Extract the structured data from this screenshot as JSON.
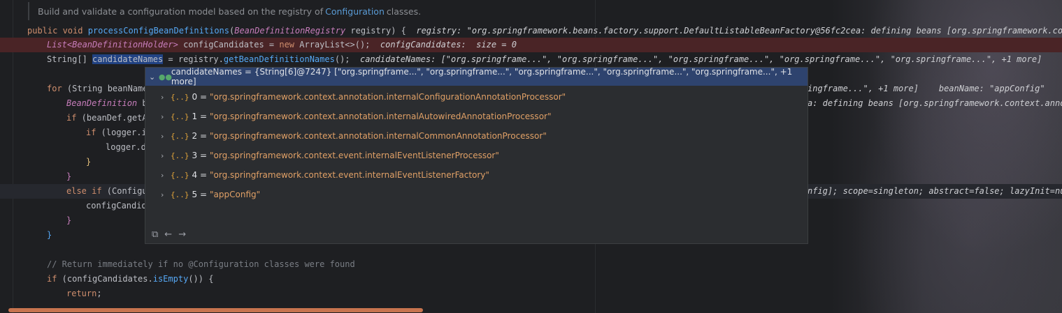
{
  "doc_comment": {
    "prefix": "Build and validate a configuration model based on the registry of",
    "link": "Configuration",
    "suffix": "classes."
  },
  "code": {
    "l1_kw": "public void ",
    "l1_fn": "processConfigBeanDefinitions",
    "l1_paren": "(",
    "l1_type": "BeanDefinitionRegistry",
    "l1_param": " registry) {",
    "l1_dbg": "registry: \"org.springframework.beans.factory.support.DefaultListableBeanFactory@56fc2cea: defining beans [org.springframework.context.",
    "l2_type": "List",
    "l2_generic": "<BeanDefinitionHolder>",
    "l2_rest": " configCandidates = ",
    "l2_new": "new ",
    "l2_ctor": "ArrayList<>();",
    "l2_dbg": "configCandidates:  size = 0",
    "l3_type": "String[] ",
    "l3_sel": "candidateNames",
    "l3_rest": " = registry.",
    "l3_fn": "getBeanDefinitionNames",
    "l3_end": "();",
    "l3_dbg": "candidateNames: [\"org.springframe...\", \"org.springframe...\", \"org.springframe...\", \"org.springframe...\", \"org.springframe...\", +1 more]",
    "l4_kw": "for",
    "l4_rest": " (String beanName",
    "l4_dbg": "ingframe...\", +1 more]    beanName: \"appConfig\"",
    "l5_type": "BeanDefinition",
    "l5_rest": " b",
    "l5_dbg": "a: defining beans [org.springframework.context.annot",
    "l6_kw": "if",
    "l6_rest": " (beanDef.getA",
    "l7_kw": "if",
    "l7_rest": " (logger.i",
    "l8_rest": "logger.d",
    "l9_rest": "}",
    "l10_rest": "}",
    "l11_kw": "else if",
    "l11_rest": " (Configu",
    "l11_dbg": "nfig]; scope=singleton; abstract=false; lazyInit=nul",
    "l12_rest": "configCandid",
    "l13_rest": "}",
    "l14_rest": "}",
    "l15_cm": "// Return immediately if no @Configuration classes were found",
    "l16_kw": "if",
    "l16_rest": " (configCandidates.",
    "l16_fn": "isEmpty",
    "l16_end": "()) {",
    "l17_kw": "return",
    "l17_end": ";"
  },
  "popup": {
    "header": "candidateNames = {String[6]@7247} [\"org.springframe...\", \"org.springframe...\", \"org.springframe...\", \"org.springframe...\", \"org.springframe...\", +1 more]",
    "brace": "{..}",
    "items": [
      {
        "index": "0 =",
        "value": "\"org.springframework.context.annotation.internalConfigurationAnnotationProcessor\""
      },
      {
        "index": "1 =",
        "value": "\"org.springframework.context.annotation.internalAutowiredAnnotationProcessor\""
      },
      {
        "index": "2 =",
        "value": "\"org.springframework.context.annotation.internalCommonAnnotationProcessor\""
      },
      {
        "index": "3 =",
        "value": "\"org.springframework.context.event.internalEventListenerProcessor\""
      },
      {
        "index": "4 =",
        "value": "\"org.springframework.context.event.internalEventListenerFactory\""
      },
      {
        "index": "5 =",
        "value": "\"appConfig\""
      }
    ],
    "footer_icons": [
      "pin-icon",
      "back-arrow-icon",
      "forward-arrow-icon"
    ]
  }
}
